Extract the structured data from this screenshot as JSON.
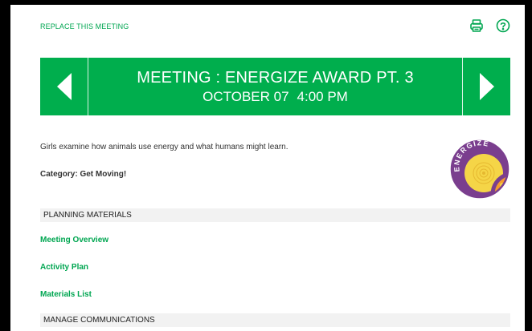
{
  "page": {
    "replace_link": "REPLACE THIS MEETING",
    "icons": {
      "print": "printer-icon",
      "help": "help-icon"
    }
  },
  "banner": {
    "title": "MEETING : ENERGIZE AWARD PT. 3",
    "date": "OCTOBER 07",
    "time": "4:00 PM",
    "prev_icon": "chevron-left-icon",
    "next_icon": "chevron-right-icon",
    "color": "#00ae4d"
  },
  "meeting": {
    "description": "Girls examine how animals use energy and what humans might learn.",
    "category": "Category: Get Moving!",
    "badge": {
      "text": "ENERGIZE",
      "icon": "energize-badge-icon"
    }
  },
  "planning": {
    "header": "PLANNING MATERIALS",
    "links": [
      "Meeting Overview",
      "Activity Plan",
      "Materials List"
    ]
  },
  "communications": {
    "header": "MANAGE COMMUNICATIONS"
  },
  "colors": {
    "accent": "#00a651",
    "section_bg": "#f2f2f2"
  }
}
